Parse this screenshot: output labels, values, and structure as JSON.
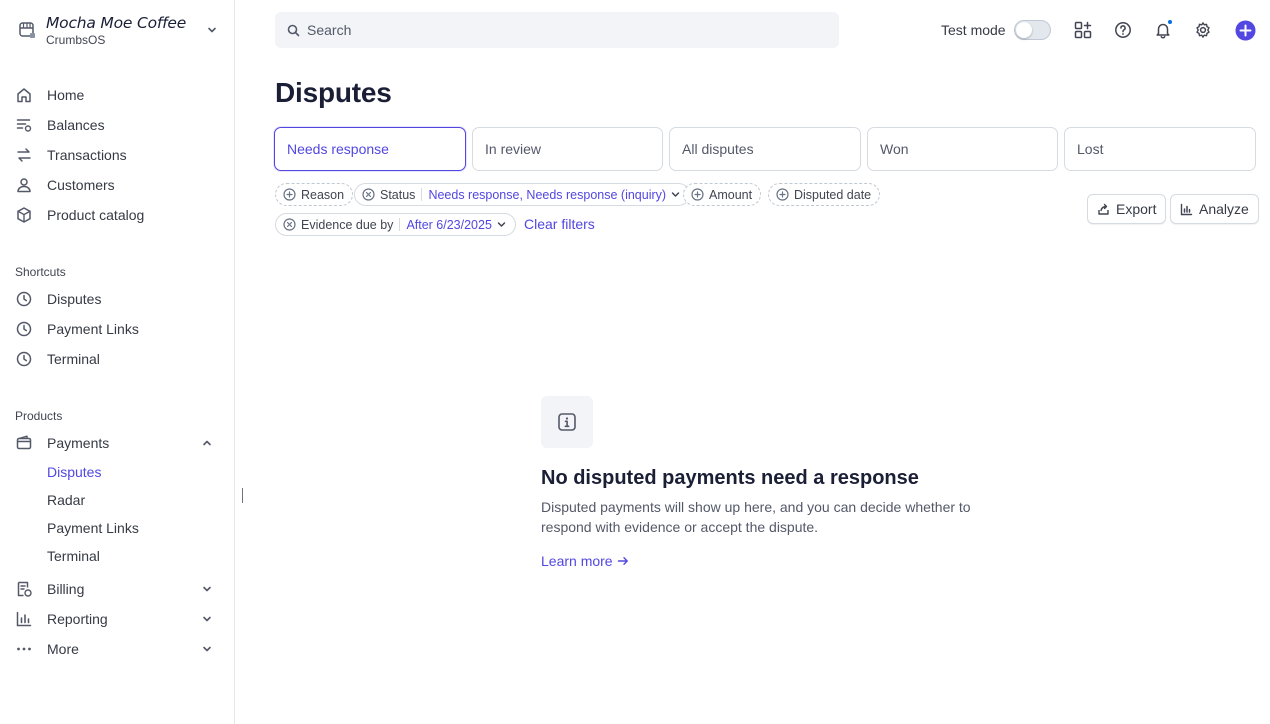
{
  "account": {
    "name": "Mocha Moe Coffee",
    "subtitle": "CrumbsOS"
  },
  "nav": {
    "home": "Home",
    "balances": "Balances",
    "transactions": "Transactions",
    "customers": "Customers",
    "product_catalog": "Product catalog"
  },
  "shortcuts": {
    "title": "Shortcuts",
    "items": [
      "Disputes",
      "Payment Links",
      "Terminal"
    ]
  },
  "products": {
    "title": "Products",
    "payments": "Payments",
    "payments_sub": [
      "Disputes",
      "Radar",
      "Payment Links",
      "Terminal"
    ],
    "billing": "Billing",
    "reporting": "Reporting",
    "more": "More"
  },
  "topbar": {
    "search_placeholder": "Search",
    "test_mode_label": "Test mode",
    "test_mode_on": false
  },
  "page": {
    "title": "Disputes",
    "tabs": [
      "Needs response",
      "In review",
      "All disputes",
      "Won",
      "Lost"
    ],
    "active_tab": "Needs response"
  },
  "filters": {
    "reason": "Reason",
    "status_label": "Status",
    "status_value": "Needs response, Needs response (inquiry)",
    "amount": "Amount",
    "disputed_date": "Disputed date",
    "evidence_label": "Evidence due by",
    "evidence_value": "After 6/23/2025",
    "clear": "Clear filters"
  },
  "actions": {
    "export": "Export",
    "analyze": "Analyze"
  },
  "empty_state": {
    "title": "No disputed payments need a response",
    "description": "Disputed payments will show up here, and you can decide whether to respond with evidence or accept the dispute.",
    "link": "Learn more"
  },
  "colors": {
    "accent": "#5247e0",
    "text": "#1a1f36",
    "muted": "#545969",
    "border": "#d5dbe1"
  }
}
